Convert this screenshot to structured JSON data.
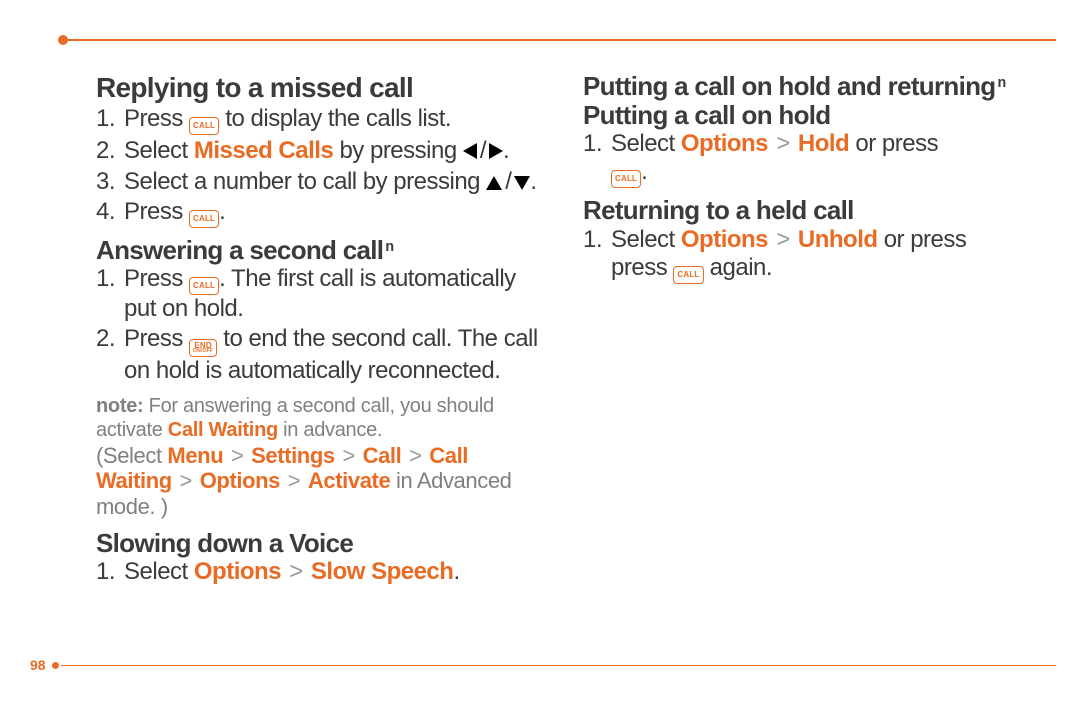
{
  "page_number": "98",
  "keys": {
    "call": "CALL",
    "end": "END",
    "end_sub": "ON/OFF"
  },
  "left": {
    "h_missed": "Replying to a missed call",
    "missed": {
      "s1a": "Press ",
      "s1b": " to display the calls list.",
      "s2a": "Select ",
      "s2_missed": "Missed Calls",
      "s2b": " by pressing ",
      "s3a": "Select a number to call by pressing ",
      "s4a": "Press "
    },
    "h_second_a": "Answering a second call",
    "sup_n": "n",
    "second": {
      "s1a": "Press ",
      "s1b": ". The first call is automatically put on hold.",
      "s2a": "Press ",
      "s2b": " to end the second call. The call on hold is automatically reconnected."
    },
    "note_label": "note:",
    "note_a": " For answering a second call, you should activate ",
    "note_hl": "Call Waiting",
    "note_b": " in advance."
  },
  "right": {
    "pnote_a": "(Select ",
    "path": [
      "Menu",
      "Settings",
      "Call",
      "Call Waiting",
      "Options",
      "Activate"
    ],
    "pnote_b": " in Advanced mode. )",
    "h_slow": "Slowing down a Voice",
    "slow_a": "Select ",
    "slow_opts": "Options",
    "slow_slow": "Slow Speech",
    "h_hold_ret_a": "Putting a call on hold and returning",
    "sup_n": "n",
    "h_hold": "Putting a call on hold",
    "hold_a": "Select ",
    "hold_opts": "Options",
    "hold_hold": "Hold",
    "hold_b": " or press ",
    "h_ret": "Returning to a held call",
    "ret_a": "Select ",
    "ret_opts": "Options",
    "ret_un": "Unhold",
    "ret_b": " or press ",
    "ret_c": " again."
  },
  "sep": ">",
  "period": "."
}
